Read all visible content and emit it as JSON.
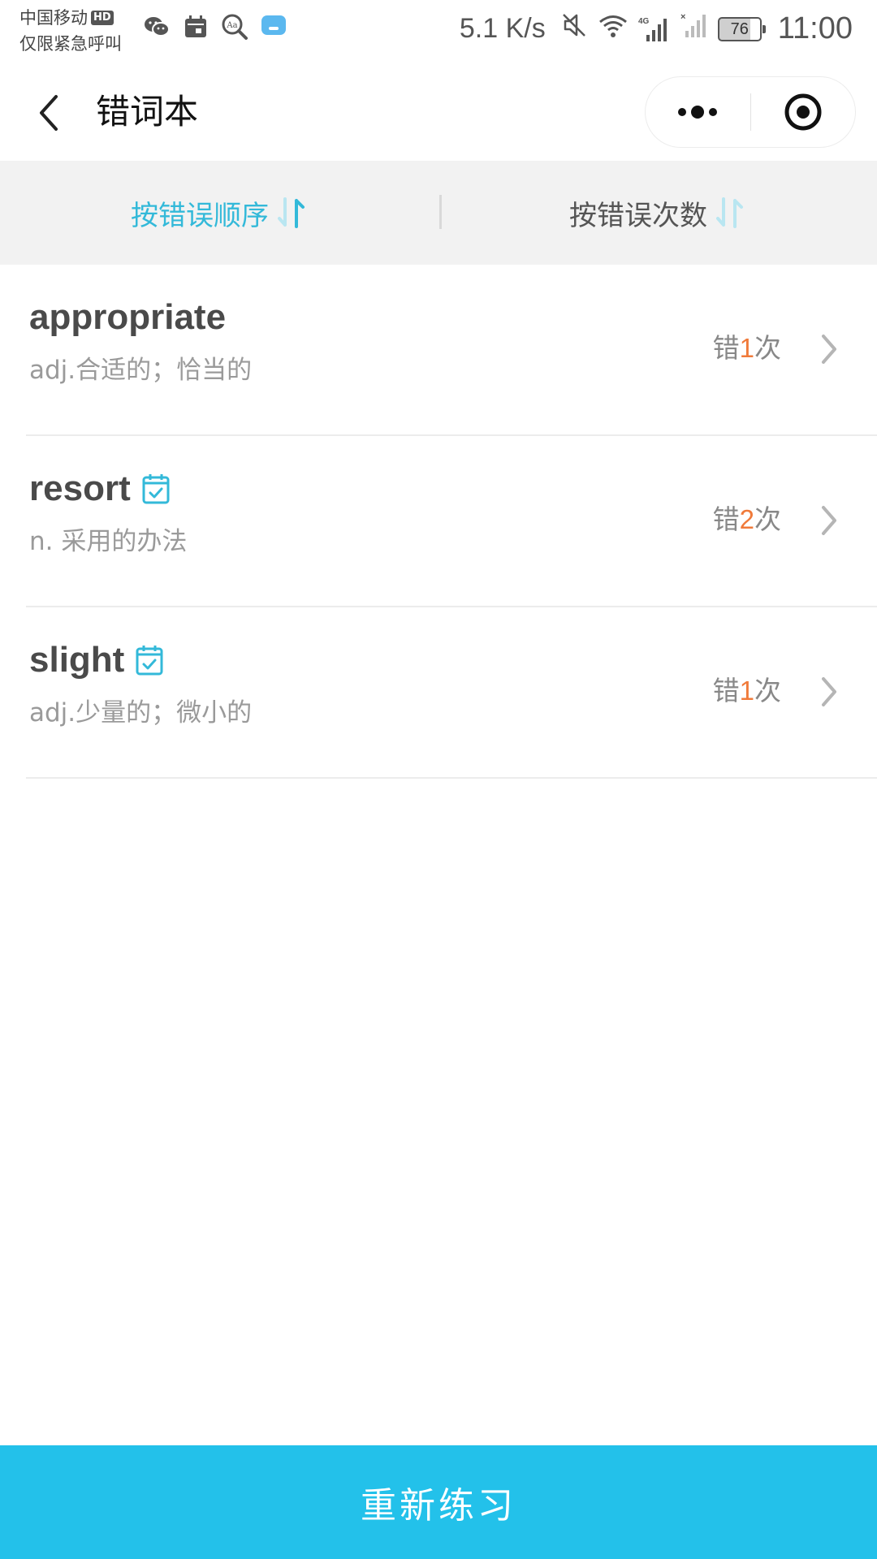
{
  "status_bar": {
    "carrier": "中国移动",
    "hd_badge": "HD",
    "emergency_text": "仅限紧急呼叫",
    "app_icons": [
      "wechat-icon",
      "calendar-icon",
      "dictionary-icon",
      "message-app-icon"
    ],
    "net_speed": "5.1 K/s",
    "network_type": "4G",
    "battery_level": "76",
    "time": "11:00"
  },
  "nav": {
    "title": "错词本"
  },
  "sort_tabs": [
    {
      "label": "按错误顺序",
      "active": true
    },
    {
      "label": "按错误次数",
      "active": false
    }
  ],
  "words": [
    {
      "word": "appropriate",
      "meaning": "adj.合适的；恰当的",
      "mastered": false,
      "error_prefix": "错",
      "error_count": "1",
      "error_suffix": "次"
    },
    {
      "word": "resort",
      "meaning": "n. 采用的办法",
      "mastered": true,
      "error_prefix": "错",
      "error_count": "2",
      "error_suffix": "次"
    },
    {
      "word": "slight",
      "meaning": "adj.少量的；微小的",
      "mastered": true,
      "error_prefix": "错",
      "error_count": "1",
      "error_suffix": "次"
    }
  ],
  "practice_button_label": "重新练习",
  "colors": {
    "accent": "#23c1ea",
    "active_tab": "#33b9d9",
    "error_count": "#f07a3a"
  }
}
